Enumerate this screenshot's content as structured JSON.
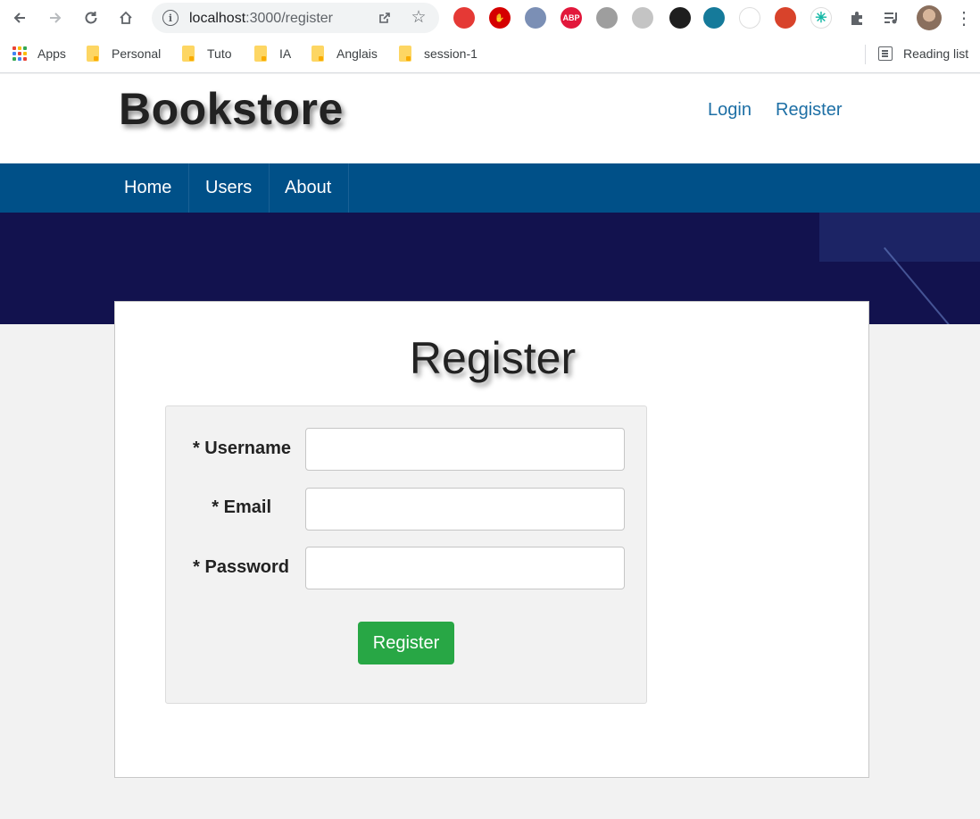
{
  "browser": {
    "url_host": "localhost",
    "url_path": ":3000/register",
    "extensions": [
      {
        "name": "ext-1",
        "color": "#e53935",
        "glyph": ""
      },
      {
        "name": "ext-2",
        "color": "#d50000",
        "glyph": "✋"
      },
      {
        "name": "ext-3",
        "color": "#7b8fb5",
        "glyph": ""
      },
      {
        "name": "adblock",
        "color": "#e2173b",
        "glyph": "ABP"
      },
      {
        "name": "ext-5",
        "color": "#9e9e9e",
        "glyph": ""
      },
      {
        "name": "ext-6",
        "color": "#c4c4c4",
        "glyph": ""
      },
      {
        "name": "ext-7",
        "color": "#1e1e1e",
        "glyph": ""
      },
      {
        "name": "ext-8",
        "color": "#157a9a",
        "glyph": ""
      },
      {
        "name": "ext-9",
        "color": "#ffffff",
        "glyph": ""
      },
      {
        "name": "ext-10",
        "color": "#d8432b",
        "glyph": ""
      },
      {
        "name": "ext-11",
        "color": "#ffffff",
        "glyph": "✳"
      }
    ],
    "bookmarks": [
      {
        "label": "Apps",
        "type": "apps"
      },
      {
        "label": "Personal",
        "type": "folder"
      },
      {
        "label": "Tuto",
        "type": "folder"
      },
      {
        "label": "IA",
        "type": "folder"
      },
      {
        "label": "Anglais",
        "type": "folder"
      },
      {
        "label": "session-1",
        "type": "folder"
      }
    ],
    "reading_list": "Reading list"
  },
  "site": {
    "brand": "Bookstore",
    "top_links": [
      "Login",
      "Register"
    ],
    "nav": [
      "Home",
      "Users",
      "About"
    ]
  },
  "form": {
    "title": "Register",
    "fields": [
      {
        "label": "* Username",
        "value": ""
      },
      {
        "label": "* Email",
        "value": ""
      },
      {
        "label": "* Password",
        "value": ""
      }
    ],
    "submit": "Register"
  },
  "colors": {
    "navbar": "#005088",
    "hero": "#12124e",
    "link": "#1d6fa5",
    "submit": "#28a745"
  }
}
